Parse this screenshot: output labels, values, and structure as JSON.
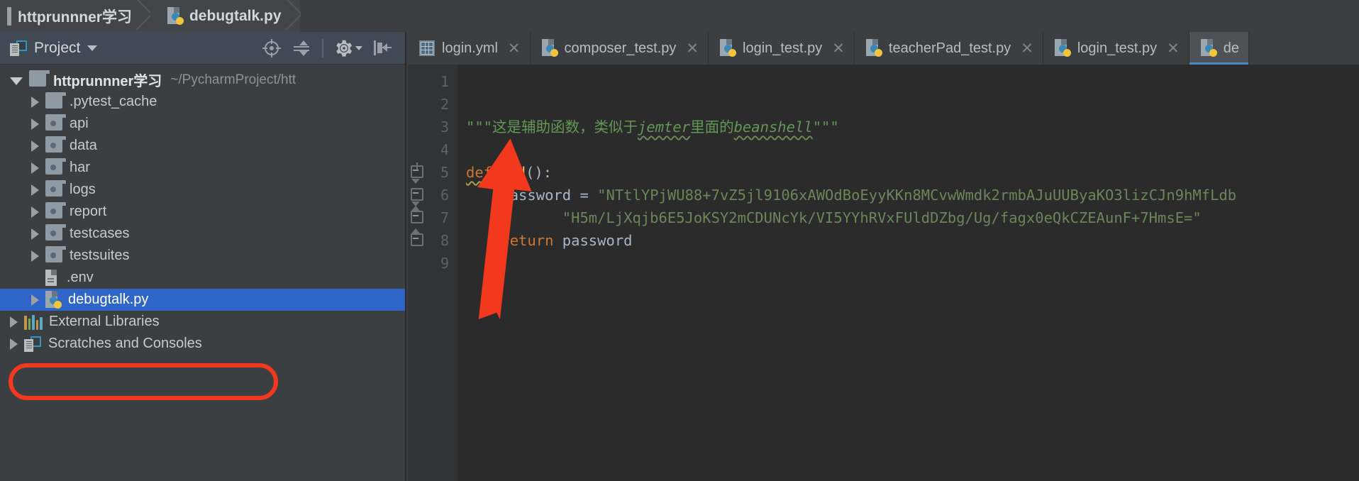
{
  "breadcrumb": {
    "items": [
      {
        "label": "httprunnner学习",
        "icon": "folder-icon"
      },
      {
        "label": "debugtalk.py",
        "icon": "python-file-icon"
      }
    ]
  },
  "project_panel": {
    "title": "Project",
    "tools": [
      {
        "name": "locate-in-tree",
        "icon": "target-icon"
      },
      {
        "name": "collapse-all",
        "icon": "collapse-all-icon"
      },
      {
        "name": "settings",
        "icon": "gear-icon"
      },
      {
        "name": "hide-panel",
        "icon": "hide-panel-icon"
      }
    ],
    "tree": [
      {
        "label": "httprunnner学习",
        "path": "~/PycharmProject/htt",
        "icon": "folder-icon",
        "state": "expanded",
        "depth": 0,
        "bold": true,
        "selected": false
      },
      {
        "label": ".pytest_cache",
        "icon": "folder-icon",
        "state": "collapsed",
        "depth": 1,
        "bold": false,
        "selected": false
      },
      {
        "label": "api",
        "icon": "source-folder-icon",
        "state": "collapsed",
        "depth": 1,
        "bold": false,
        "selected": false
      },
      {
        "label": "data",
        "icon": "source-folder-icon",
        "state": "collapsed",
        "depth": 1,
        "bold": false,
        "selected": false
      },
      {
        "label": "har",
        "icon": "source-folder-icon",
        "state": "collapsed",
        "depth": 1,
        "bold": false,
        "selected": false
      },
      {
        "label": "logs",
        "icon": "source-folder-icon",
        "state": "collapsed",
        "depth": 1,
        "bold": false,
        "selected": false
      },
      {
        "label": "report",
        "icon": "source-folder-icon",
        "state": "collapsed",
        "depth": 1,
        "bold": false,
        "selected": false
      },
      {
        "label": "testcases",
        "icon": "source-folder-icon",
        "state": "collapsed",
        "depth": 1,
        "bold": false,
        "selected": false
      },
      {
        "label": "testsuites",
        "icon": "source-folder-icon",
        "state": "collapsed",
        "depth": 1,
        "bold": false,
        "selected": false
      },
      {
        "label": ".env",
        "icon": "file-icon",
        "state": "none",
        "depth": 1,
        "bold": false,
        "selected": false
      },
      {
        "label": "debugtalk.py",
        "icon": "python-file-icon",
        "state": "collapsed",
        "depth": 1,
        "bold": false,
        "selected": true
      },
      {
        "label": "External Libraries",
        "icon": "libraries-icon",
        "state": "collapsed",
        "depth": 0,
        "bold": false,
        "selected": false
      },
      {
        "label": "Scratches and Consoles",
        "icon": "scratches-icon",
        "state": "collapsed",
        "depth": 0,
        "bold": false,
        "selected": false
      }
    ]
  },
  "editor": {
    "tabs": [
      {
        "label": "login.yml",
        "icon": "yaml-file-icon",
        "active": false,
        "closable": true
      },
      {
        "label": "composer_test.py",
        "icon": "python-file-icon",
        "active": false,
        "closable": true
      },
      {
        "label": "login_test.py",
        "icon": "python-file-icon",
        "active": false,
        "closable": true
      },
      {
        "label": "teacherPad_test.py",
        "icon": "python-file-icon",
        "active": false,
        "closable": true
      },
      {
        "label": "login_test.py",
        "icon": "python-file-icon",
        "active": false,
        "closable": true
      },
      {
        "label": "de",
        "icon": "python-file-icon",
        "active": true,
        "closable": false
      }
    ],
    "line_numbers": [
      "1",
      "2",
      "3",
      "4",
      "5",
      "6",
      "7",
      "8",
      "9"
    ],
    "code": {
      "line3_docstring_open": "\"\"\"",
      "line3_text_a": "这是辅助函数，类似于",
      "line3_word_jemter": "jemter",
      "line3_text_b": "里面的",
      "line3_word_beanshell": "beanshell",
      "line3_docstring_close": "\"\"\"",
      "line5_kw_def": "def",
      "line5_fn": "pwd",
      "line5_rest": "():",
      "line6_var": "password",
      "line6_eq": " = ",
      "line6_str": "\"NTtlYPjWU88+7vZ5jl9106xAWOdBoEyyKKn8MCvwWmdk2rmbAJuUUByaKO3lizCJn9hMfLdb",
      "line7_str": "\"H5m/LjXqjb6E5JoKSY2mCDUNcYk/VI5YYhRVxFUldDZbg/Ug/fagx0eQkCZEAunF+7HmsE=\"",
      "line8_kw_return": "return",
      "line8_var": " password"
    }
  },
  "annotations": {
    "oval_color": "#f2391d",
    "arrow_color": "#f2391d",
    "oval_target": "debugtalk.py",
    "arrow_target": "password"
  },
  "colors": {
    "panel_bg": "#3c3f41",
    "editor_bg": "#2b2b2b",
    "gutter_bg": "#313335",
    "selection_blue": "#2f65c8",
    "tab_active_bg": "#4e5254",
    "tab_underline": "#4a88c7",
    "string_green": "#6a8759",
    "keyword_orange": "#cc7832",
    "function_yellow": "#ffc66d",
    "text_default": "#a9b7c6"
  }
}
